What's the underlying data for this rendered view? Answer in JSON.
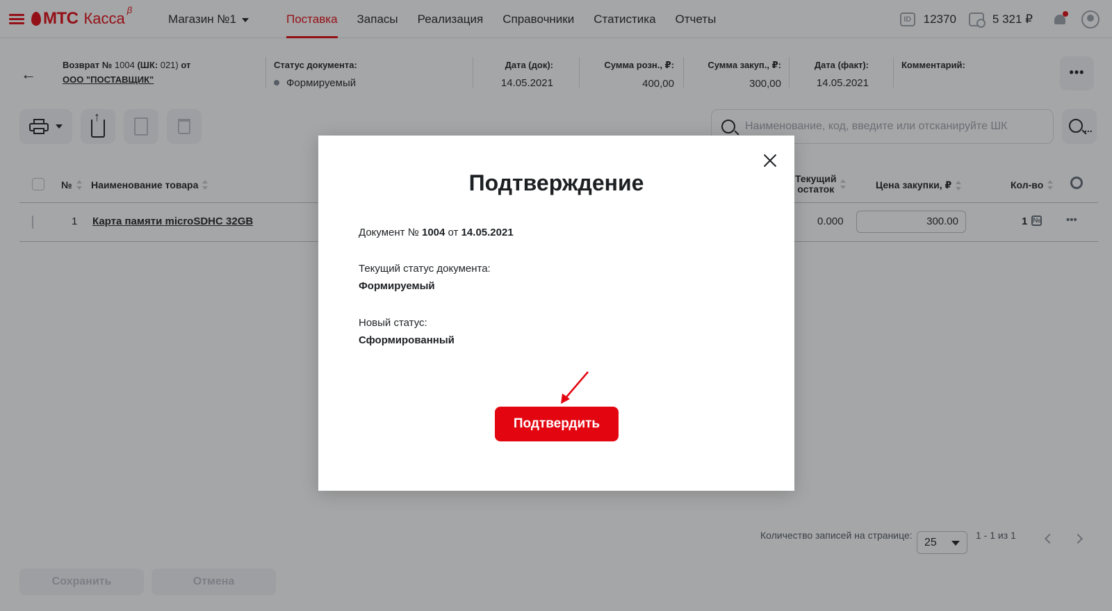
{
  "nav": {
    "logo": "МТС",
    "product": "Касса",
    "beta": "β",
    "store": "Магазин №1",
    "items": [
      {
        "label": "Поставка",
        "active": true
      },
      {
        "label": "Запасы",
        "active": false
      },
      {
        "label": "Реализация",
        "active": false
      },
      {
        "label": "Справочники",
        "active": false
      },
      {
        "label": "Статистика",
        "active": false
      },
      {
        "label": "Отчеты",
        "active": false
      }
    ],
    "id_badge": "ID",
    "id_value": "12370",
    "balance": "5 321 ₽",
    "icons": [
      "menu-icon",
      "id-icon",
      "wallet-icon",
      "bell-icon",
      "avatar-icon"
    ]
  },
  "doc": {
    "title_prefix": "Возврат №",
    "number": "1004",
    "barcode_label": "(ШК:",
    "barcode_value": "021)",
    "from": "от",
    "supplier": "ООО \"ПОСТАВЩИК\"",
    "status_label": "Статус документа:",
    "status_value": "Формируемый",
    "date_doc_label": "Дата (док):",
    "date_doc_value": "14.05.2021",
    "sum_retail_label": "Сумма розн., ₽:",
    "sum_retail_value": "400,00",
    "sum_purchase_label": "Сумма закуп., ₽:",
    "sum_purchase_value": "300,00",
    "date_fact_label": "Дата (факт):",
    "date_fact_value": "14.05.2021",
    "comment_label": "Комментарий:",
    "more": "•••"
  },
  "search": {
    "placeholder": "Наименование, код, введите или отсканируйте ШК",
    "adv_dots": "..."
  },
  "table": {
    "headers": {
      "num": "№",
      "name": "Наименование товара",
      "stock_line1": "Текущий",
      "stock_line2": "остаток",
      "price": "Цена закупки, ₽",
      "qty": "Кол-во"
    },
    "rows": [
      {
        "num": "1",
        "name": "Карта памяти microSDHC 32GB",
        "stock": "0.000",
        "price": "300.00",
        "qty": "1",
        "code_icon": "№",
        "more": "•••"
      }
    ]
  },
  "pager": {
    "per_page_label": "Количество записей на странице:",
    "per_page": "25",
    "range": "1 - 1 из 1"
  },
  "footer": {
    "save": "Сохранить",
    "cancel": "Отмена"
  },
  "modal": {
    "title": "Подтверждение",
    "doc_prefix": "Документ №",
    "doc_number": "1004",
    "doc_from": "от",
    "doc_date": "14.05.2021",
    "current_status_label": "Текущий статус документа:",
    "current_status_value": "Формируемый",
    "new_status_label": "Новый статус:",
    "new_status_value": "Сформированный",
    "confirm": "Подтвердить"
  },
  "colors": {
    "accent": "#e30611",
    "text": "#1d2023",
    "muted": "#9ca3ac"
  }
}
